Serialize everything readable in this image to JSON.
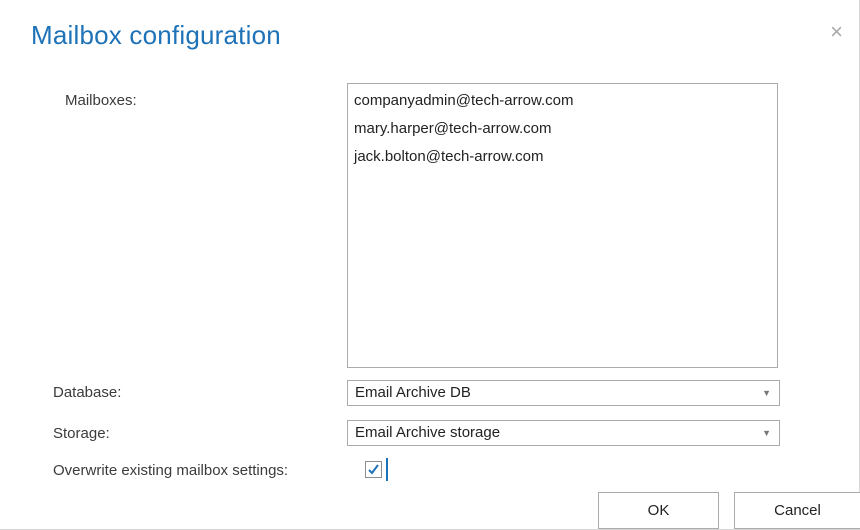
{
  "dialog": {
    "title": "Mailbox configuration",
    "close_symbol": "×"
  },
  "form": {
    "mailboxes_label": "Mailboxes:",
    "mailboxes": [
      "companyadmin@tech-arrow.com",
      "mary.harper@tech-arrow.com",
      "jack.bolton@tech-arrow.com"
    ],
    "database_label": "Database:",
    "database_value": "Email Archive DB",
    "storage_label": "Storage:",
    "storage_value": "Email Archive storage",
    "overwrite_label": "Overwrite existing mailbox settings:",
    "overwrite_checked": true
  },
  "buttons": {
    "ok": "OK",
    "cancel": "Cancel"
  },
  "icons": {
    "close": "close-icon",
    "dropdown": "chevron-down-icon",
    "check": "check-icon"
  },
  "colors": {
    "title": "#1e72b8",
    "border": "#ababab",
    "check": "#1e72b8"
  }
}
